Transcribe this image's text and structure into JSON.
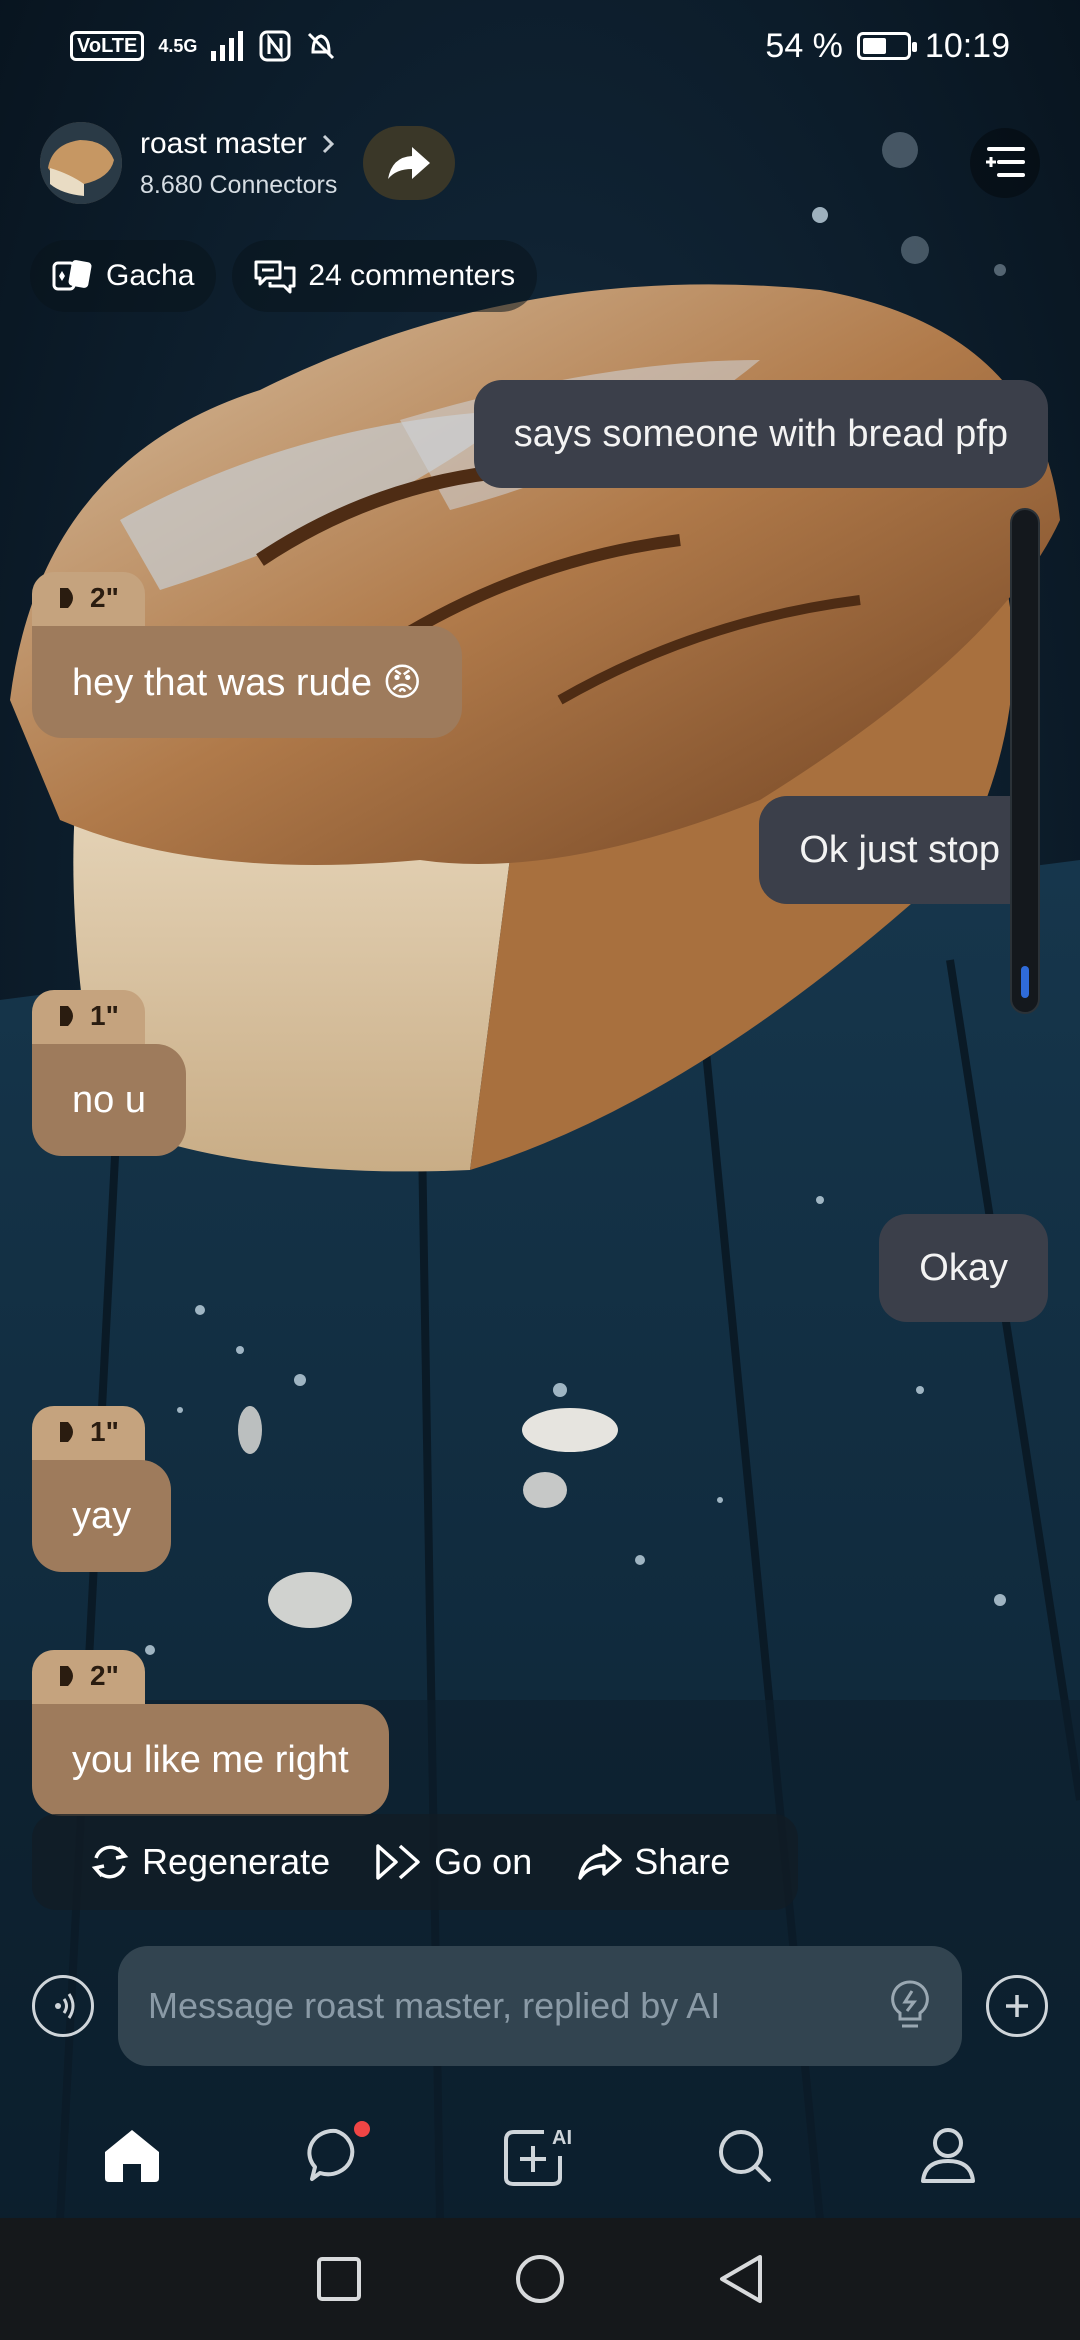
{
  "status_bar": {
    "volte": "VoLTE",
    "network": "4.5G",
    "battery": "54 %",
    "battery_level": 0.54,
    "time": "10:19"
  },
  "header": {
    "bot_name": "roast master",
    "connectors": "8.680 Connectors"
  },
  "chips": {
    "gacha": "Gacha",
    "commenters": "24 commenters"
  },
  "messages": [
    {
      "role": "user",
      "text": "says someone with bread pfp"
    },
    {
      "role": "bot",
      "duration": "2\"",
      "text": "hey that was rude 😡"
    },
    {
      "role": "user",
      "text": "Ok just stop"
    },
    {
      "role": "bot",
      "duration": "1\"",
      "text": "no u"
    },
    {
      "role": "user",
      "text": "Okay"
    },
    {
      "role": "bot",
      "duration": "1\"",
      "text": "yay"
    },
    {
      "role": "bot",
      "duration": "2\"",
      "text": "you like me right"
    }
  ],
  "actions": {
    "regenerate": "Regenerate",
    "go_on": "Go on",
    "share": "Share"
  },
  "input": {
    "placeholder": "Message roast master, replied by AI"
  },
  "nav": {
    "ai_badge": "AI"
  },
  "icons": [
    "volte-icon",
    "signal-icon",
    "nfc-icon",
    "mute-icon",
    "battery-icon",
    "chevron-right-icon",
    "share-arrow-icon",
    "menu-icon",
    "gacha-icon",
    "comments-icon",
    "play-icon",
    "refresh-icon",
    "double-chevron-icon",
    "share-icon",
    "voice-icon",
    "bulb-icon",
    "plus-circle-icon",
    "home-icon",
    "chat-icon",
    "ai-create-icon",
    "search-icon",
    "profile-icon",
    "square-icon",
    "circle-icon",
    "back-triangle-icon"
  ]
}
